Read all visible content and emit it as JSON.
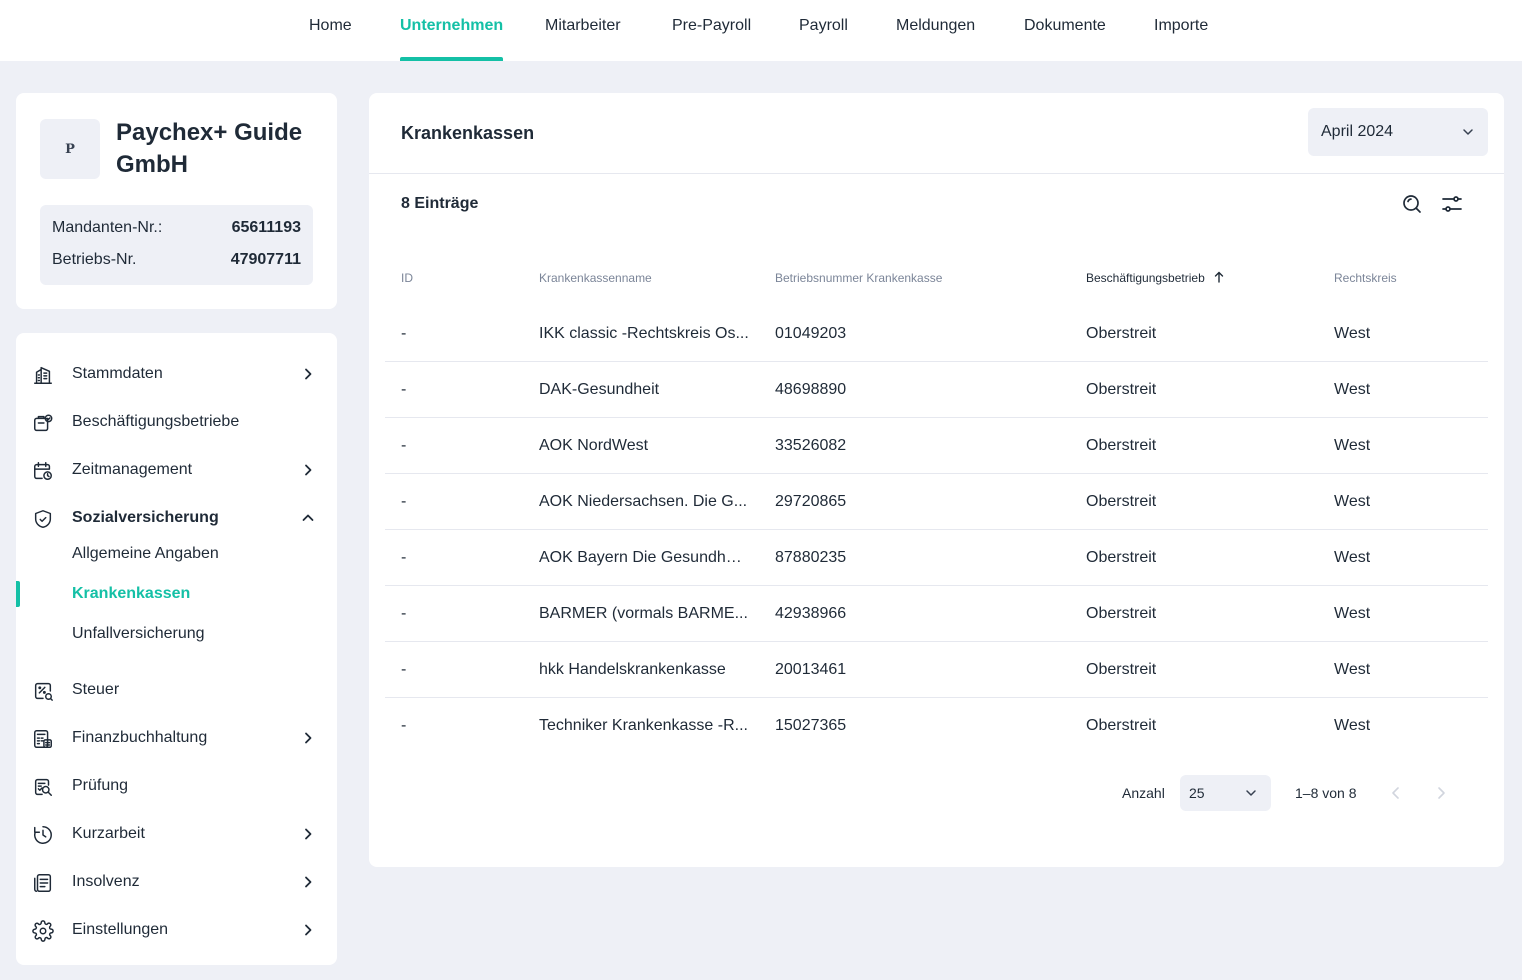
{
  "topnav": {
    "items": [
      {
        "label": "Home",
        "active": false
      },
      {
        "label": "Unternehmen",
        "active": true
      },
      {
        "label": "Mitarbeiter",
        "active": false
      },
      {
        "label": "Pre-Payroll",
        "active": false
      },
      {
        "label": "Payroll",
        "active": false
      },
      {
        "label": "Meldungen",
        "active": false
      },
      {
        "label": "Dokumente",
        "active": false
      },
      {
        "label": "Importe",
        "active": false
      }
    ]
  },
  "company": {
    "logo_letter": "P",
    "name": "Paychex+ Guide GmbH",
    "mandant_label": "Mandanten-Nr.:",
    "mandant_value": "65611193",
    "betrieb_label": "Betriebs-Nr.",
    "betrieb_value": "47907711"
  },
  "sidebar": {
    "items": [
      {
        "label": "Stammdaten",
        "icon": "building-icon",
        "chevron": "right"
      },
      {
        "label": "Beschäftigungsbetriebe",
        "icon": "briefcase-icon",
        "chevron": "none"
      },
      {
        "label": "Zeitmanagement",
        "icon": "calendar-clock-icon",
        "chevron": "right"
      },
      {
        "label": "Sozialversicherung",
        "icon": "shield-icon",
        "chevron": "up",
        "expanded": true
      },
      {
        "label": "Steuer",
        "icon": "percent-receipt-icon",
        "chevron": "none"
      },
      {
        "label": "Finanzbuchhaltung",
        "icon": "calculator-icon",
        "chevron": "right"
      },
      {
        "label": "Prüfung",
        "icon": "audit-search-icon",
        "chevron": "none"
      },
      {
        "label": "Kurzarbeit",
        "icon": "clock-icon",
        "chevron": "right"
      },
      {
        "label": "Insolvenz",
        "icon": "document-list-icon",
        "chevron": "right"
      },
      {
        "label": "Einstellungen",
        "icon": "gear-icon",
        "chevron": "right"
      }
    ],
    "subitems": [
      {
        "label": "Allgemeine Angaben",
        "active": false
      },
      {
        "label": "Krankenkassen",
        "active": true
      },
      {
        "label": "Unfallversicherung",
        "active": false
      }
    ]
  },
  "main": {
    "title": "Krankenkassen",
    "month": "April 2024",
    "count": "8 Einträge",
    "columns": {
      "id": "ID",
      "name": "Krankenkassenname",
      "nummer": "Betriebsnummer Krankenkasse",
      "betrieb": "Beschäftigungsbetrieb",
      "rechtskreis": "Rechtskreis"
    },
    "rows": [
      {
        "id": "-",
        "name": "IKK classic -Rechtskreis Os...",
        "nummer": "01049203",
        "betrieb": "Oberstreit",
        "rechtskreis": "West"
      },
      {
        "id": "-",
        "name": "DAK-Gesundheit",
        "nummer": "48698890",
        "betrieb": "Oberstreit",
        "rechtskreis": "West"
      },
      {
        "id": "-",
        "name": "AOK NordWest",
        "nummer": "33526082",
        "betrieb": "Oberstreit",
        "rechtskreis": "West"
      },
      {
        "id": "-",
        "name": "AOK Niedersachsen. Die G...",
        "nummer": "29720865",
        "betrieb": "Oberstreit",
        "rechtskreis": "West"
      },
      {
        "id": "-",
        "name": "AOK Bayern Die Gesundhei...",
        "nummer": "87880235",
        "betrieb": "Oberstreit",
        "rechtskreis": "West"
      },
      {
        "id": "-",
        "name": "BARMER (vormals BARME...",
        "nummer": "42938966",
        "betrieb": "Oberstreit",
        "rechtskreis": "West"
      },
      {
        "id": "-",
        "name": "hkk Handelskrankenkasse",
        "nummer": "20013461",
        "betrieb": "Oberstreit",
        "rechtskreis": "West"
      },
      {
        "id": "-",
        "name": "Techniker Krankenkasse -R...",
        "nummer": "15027365",
        "betrieb": "Oberstreit",
        "rechtskreis": "West"
      }
    ],
    "pager": {
      "label": "Anzahl",
      "per_page": "25",
      "range": "1–8 von 8"
    }
  },
  "colors": {
    "accent": "#14c0a6",
    "background": "#eef0f6",
    "text": "#1f2a37",
    "muted": "#7b8598"
  }
}
